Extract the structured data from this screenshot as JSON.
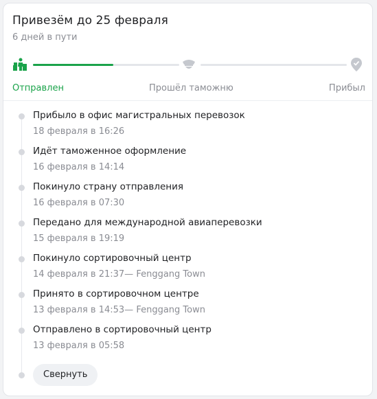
{
  "header": {
    "title": "Привезём до 25 февраля",
    "subtitle": "6 дней в пути"
  },
  "progress": {
    "fraction": 0.55,
    "stages": [
      {
        "label": "Отправлен",
        "icon": "shipment-icon",
        "state": "done",
        "color": "#1aa34a"
      },
      {
        "label": "Прошёл таможню",
        "icon": "customs-officer-icon",
        "state": "pending",
        "color": "#c5c8ce"
      },
      {
        "label": "Прибыл",
        "icon": "location-pin-check-icon",
        "state": "pending",
        "color": "#c5c8ce"
      }
    ]
  },
  "events": [
    {
      "title": "Прибыло в офис магистральных перевозок",
      "time": "18 февраля в 16:26"
    },
    {
      "title": "Идёт таможенное оформление",
      "time": "16 февраля в 14:14"
    },
    {
      "title": "Покинуло страну отправления",
      "time": "16 февраля в 07:30"
    },
    {
      "title": "Передано для международной авиаперевозки",
      "time": "15 февраля в 19:19"
    },
    {
      "title": "Покинуло сортировочный центр",
      "time": "14 февраля в 21:37— Fenggang Town"
    },
    {
      "title": "Принято в сортировочном центре",
      "time": "13 февраля в 14:53— Fenggang Town"
    },
    {
      "title": "Отправлено в сортировочный центр",
      "time": "13 февраля в 05:58"
    }
  ],
  "collapse_label": "Свернуть"
}
